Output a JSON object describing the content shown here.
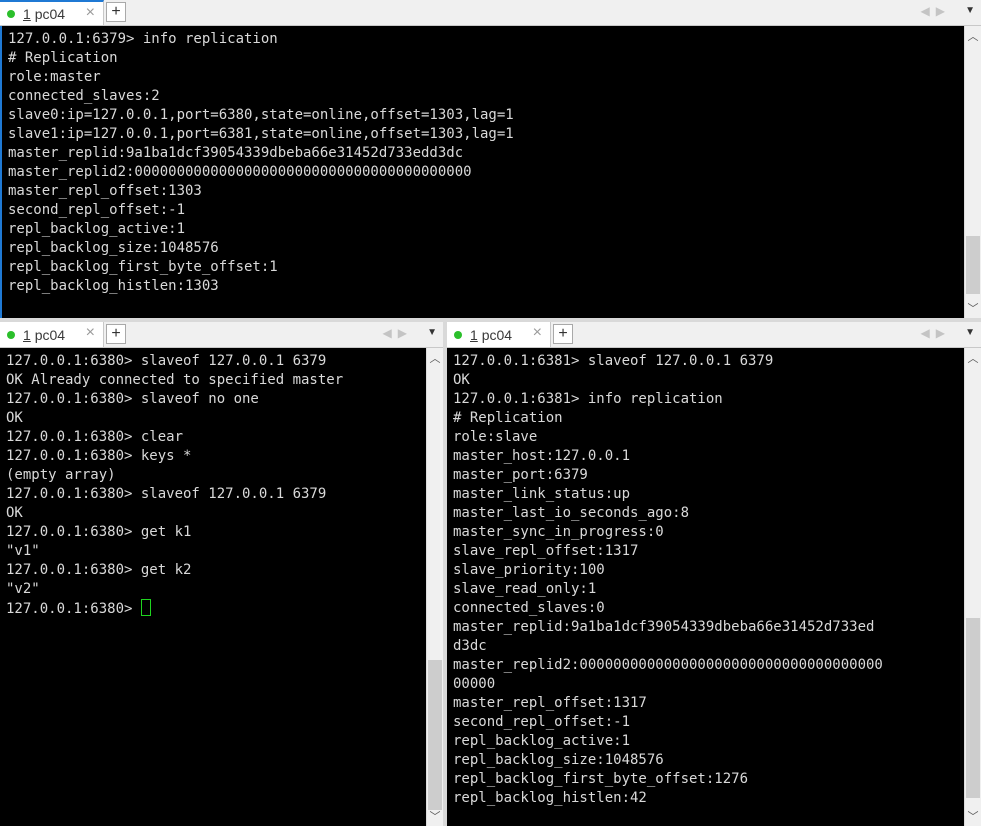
{
  "top_pane": {
    "tab": {
      "number": "1",
      "name": "pc04",
      "close": "×"
    },
    "add": "+",
    "lines": [
      "127.0.0.1:6379> info replication",
      "# Replication",
      "role:master",
      "connected_slaves:2",
      "slave0:ip=127.0.0.1,port=6380,state=online,offset=1303,lag=1",
      "slave1:ip=127.0.0.1,port=6381,state=online,offset=1303,lag=1",
      "master_replid:9a1ba1dcf39054339dbeba66e31452d733edd3dc",
      "master_replid2:0000000000000000000000000000000000000000",
      "master_repl_offset:1303",
      "second_repl_offset:-1",
      "repl_backlog_active:1",
      "repl_backlog_size:1048576",
      "repl_backlog_first_byte_offset:1",
      "repl_backlog_histlen:1303"
    ]
  },
  "left_pane": {
    "tab": {
      "number": "1",
      "name": "pc04",
      "close": "×"
    },
    "add": "+",
    "lines": [
      "127.0.0.1:6380> slaveof 127.0.0.1 6379",
      "OK Already connected to specified master",
      "127.0.0.1:6380> slaveof no one",
      "OK",
      "127.0.0.1:6380> clear",
      "127.0.0.1:6380> keys *",
      "(empty array)",
      "127.0.0.1:6380> slaveof 127.0.0.1 6379",
      "OK",
      "127.0.0.1:6380> get k1",
      "\"v1\"",
      "127.0.0.1:6380> get k2",
      "\"v2\""
    ],
    "prompt": "127.0.0.1:6380> "
  },
  "right_pane": {
    "tab": {
      "number": "1",
      "name": "pc04",
      "close": "×"
    },
    "add": "+",
    "lines": [
      "127.0.0.1:6381> slaveof 127.0.0.1 6379",
      "OK",
      "127.0.0.1:6381> info replication",
      "# Replication",
      "role:slave",
      "master_host:127.0.0.1",
      "master_port:6379",
      "master_link_status:up",
      "master_last_io_seconds_ago:8",
      "master_sync_in_progress:0",
      "slave_repl_offset:1317",
      "slave_priority:100",
      "slave_read_only:1",
      "connected_slaves:0",
      "master_replid:9a1ba1dcf39054339dbeba66e31452d733ed",
      "d3dc",
      "master_replid2:000000000000000000000000000000000000",
      "00000",
      "master_repl_offset:1317",
      "second_repl_offset:-1",
      "repl_backlog_active:1",
      "repl_backlog_size:1048576",
      "repl_backlog_first_byte_offset:1276",
      "repl_backlog_histlen:42"
    ]
  },
  "icons": {
    "nav_prev": "◀",
    "nav_next": "▶",
    "menu": "▼",
    "scroll_up": "︿",
    "scroll_down": "﹀"
  }
}
